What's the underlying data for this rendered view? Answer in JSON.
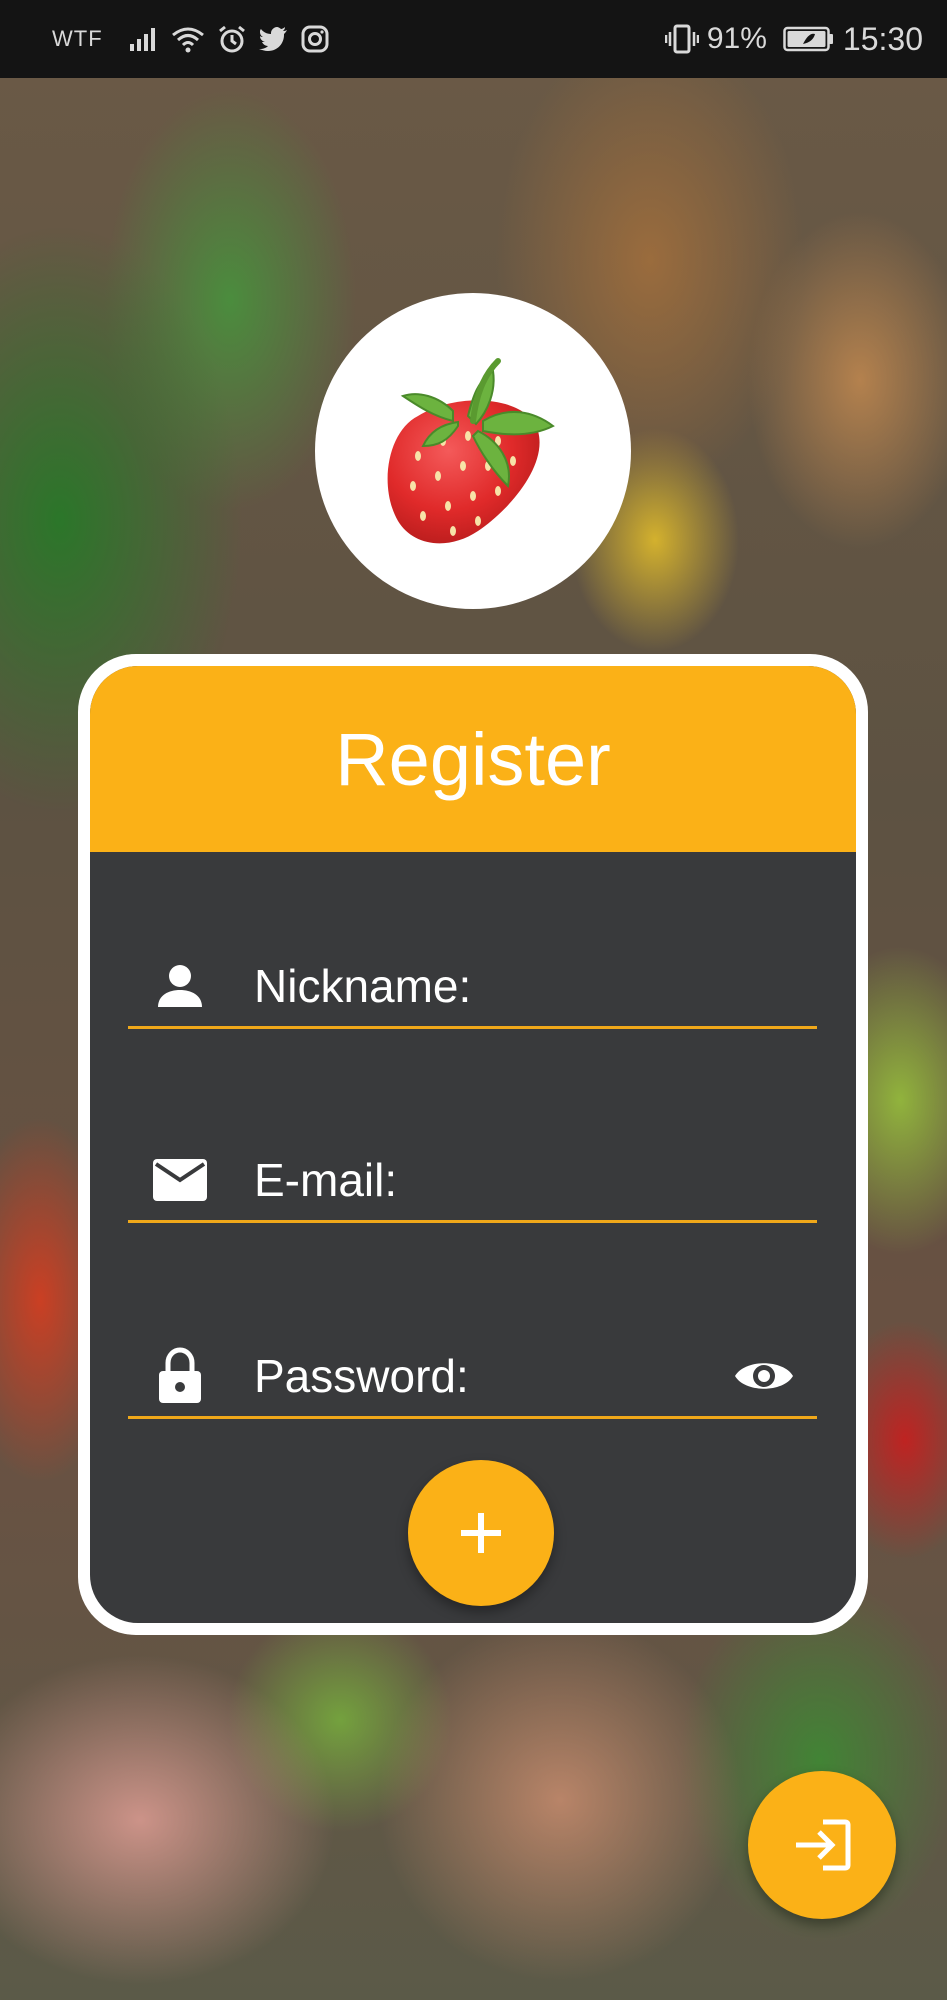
{
  "status_bar": {
    "carrier": "WTF",
    "battery": "91%",
    "time": "15:30",
    "icons": [
      "signal-icon",
      "wifi-icon",
      "alarm-icon",
      "twitter-icon",
      "instagram-icon",
      "vibrate-icon",
      "battery-icon"
    ]
  },
  "logo": {
    "icon": "strawberry-icon"
  },
  "card": {
    "title": "Register",
    "fields": {
      "nickname": {
        "label": "Nickname:",
        "icon": "person-icon"
      },
      "email": {
        "label": "E-mail:",
        "icon": "mail-icon"
      },
      "password": {
        "label": "Password:",
        "icon": "lock-icon",
        "toggle_icon": "eye-icon"
      }
    },
    "add_button_icon": "plus-icon"
  },
  "login_button_icon": "login-icon",
  "colors": {
    "accent": "#fbb117",
    "card_body": "#393a3c",
    "card_border": "#ffffff",
    "status_bar": "#141414"
  }
}
